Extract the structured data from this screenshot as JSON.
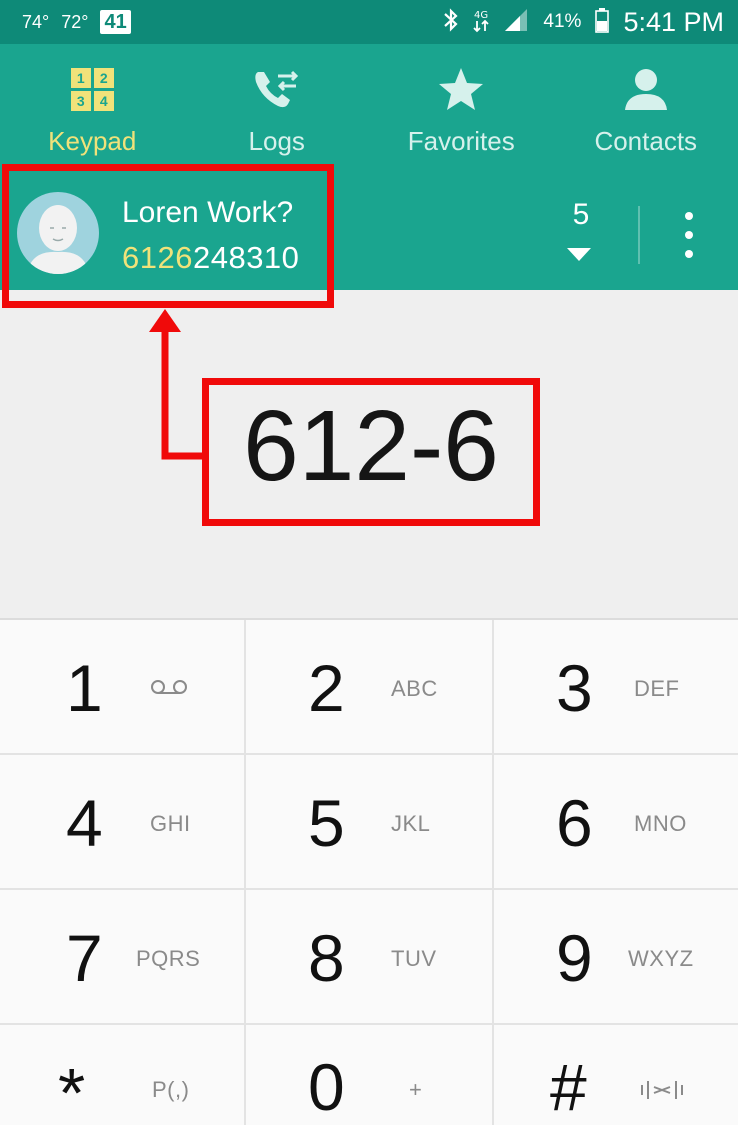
{
  "status_bar": {
    "temp1": "74°",
    "temp2": "72°",
    "badge": "41",
    "battery": "41%",
    "time": "5:41 PM",
    "icons": [
      "bluetooth-icon",
      "data-arrows-icon",
      "signal-icon",
      "battery-icon"
    ]
  },
  "tabs": [
    {
      "label": "Keypad",
      "icon": "keypad-icon",
      "active": true
    },
    {
      "label": "Logs",
      "icon": "phone-logs-icon",
      "active": false
    },
    {
      "label": "Favorites",
      "icon": "star-icon",
      "active": false
    },
    {
      "label": "Contacts",
      "icon": "person-icon",
      "active": false
    }
  ],
  "keypad_icon_digits": [
    "1",
    "2",
    "3",
    "4"
  ],
  "suggestion": {
    "name": "Loren Work?",
    "number_match": "6126",
    "number_rest": "248310",
    "results_count": "5"
  },
  "dialed": "612-6",
  "keys": [
    {
      "digit": "1",
      "letters": "QO"
    },
    {
      "digit": "2",
      "letters": "ABC"
    },
    {
      "digit": "3",
      "letters": "DEF"
    },
    {
      "digit": "4",
      "letters": "GHI"
    },
    {
      "digit": "5",
      "letters": "JKL"
    },
    {
      "digit": "6",
      "letters": "MNO"
    },
    {
      "digit": "7",
      "letters": "PQRS"
    },
    {
      "digit": "8",
      "letters": "TUV"
    },
    {
      "digit": "9",
      "letters": "WXYZ"
    },
    {
      "digit": "*",
      "letters": "P(,)"
    },
    {
      "digit": "0",
      "letters": "+"
    },
    {
      "digit": "#",
      "letters": ""
    }
  ],
  "colors": {
    "header": "#1aa58f",
    "status": "#0e8a78",
    "accent": "#f0e27a",
    "annotation": "#f00a0a"
  }
}
